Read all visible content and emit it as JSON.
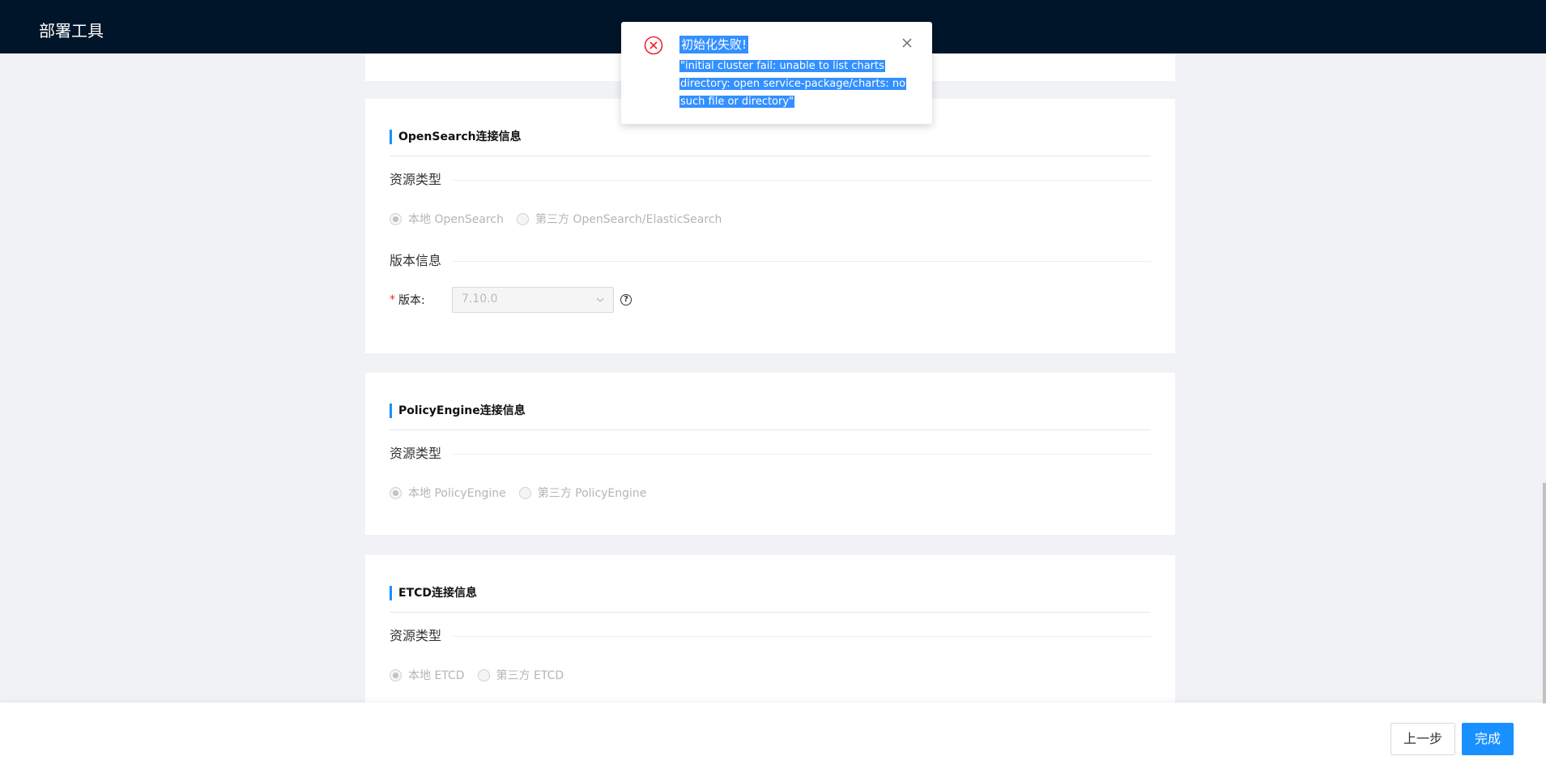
{
  "header": {
    "title": "部署工具"
  },
  "toast": {
    "icon": "error-circle-icon",
    "title": "初始化失败!",
    "message_lines": [
      "\"initial cluster fail: unable to list charts",
      "directory: open service-package/charts: no",
      "such file or directory\""
    ],
    "selection_color": "#3390ff"
  },
  "sections": {
    "opensearch": {
      "title": "OpenSearch连接信息",
      "resource_subtitle": "资源类型",
      "options": [
        "本地 OpenSearch",
        "第三方 OpenSearch/ElasticSearch"
      ],
      "selected_index": 0,
      "version_subtitle": "版本信息",
      "version_label": "版本:",
      "version_value": "7.10.0"
    },
    "policyengine": {
      "title": "PolicyEngine连接信息",
      "resource_subtitle": "资源类型",
      "options": [
        "本地 PolicyEngine",
        "第三方 PolicyEngine"
      ],
      "selected_index": 0
    },
    "etcd": {
      "title": "ETCD连接信息",
      "resource_subtitle": "资源类型",
      "options": [
        "本地 ETCD",
        "第三方 ETCD"
      ],
      "selected_index": 0
    }
  },
  "footer": {
    "prev_label": "上一步",
    "finish_label": "完成"
  },
  "colors": {
    "header_bg": "#001529",
    "accent": "#1890ff",
    "error": "#f5222d"
  }
}
